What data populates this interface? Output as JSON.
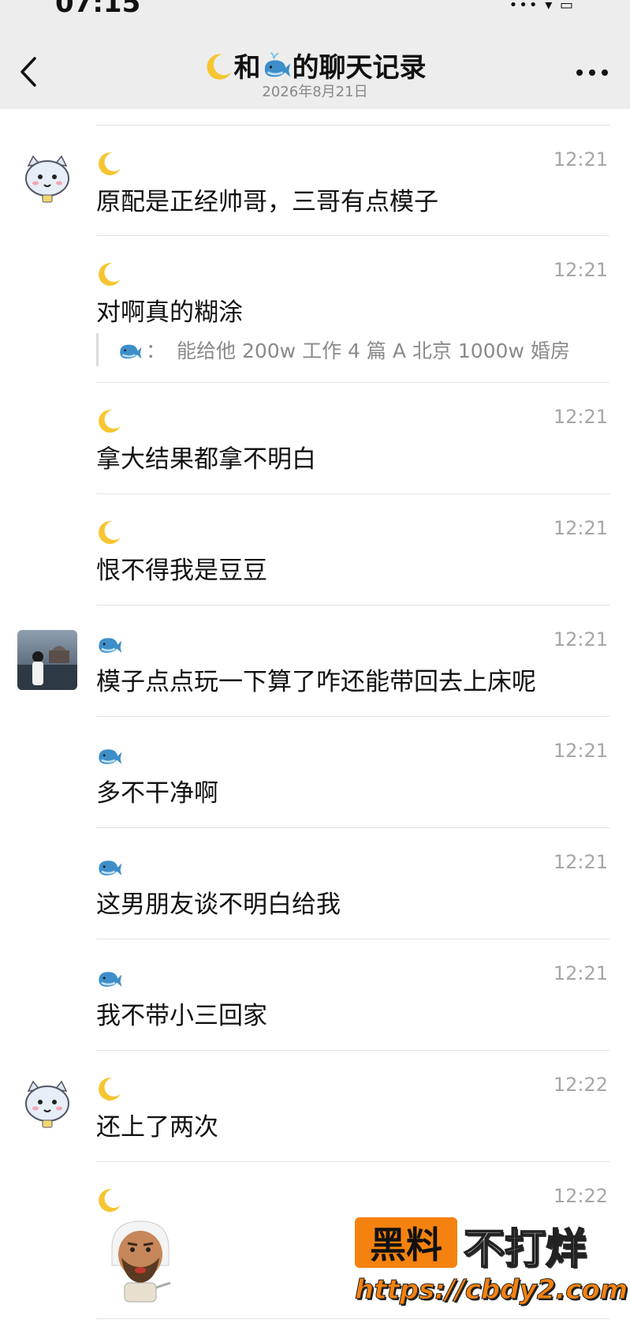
{
  "status_bar": {
    "time": "07:15",
    "indicators": "•••  ▾  ▭"
  },
  "header": {
    "title_left_icon": "moon-emoji",
    "title_mid": "和",
    "title_right_icon": "whale-emoji",
    "title_suffix": "的聊天记录",
    "date": "2026年8月21日",
    "back_icon": "chevron-left-icon",
    "more_icon": "more-dots-icon"
  },
  "messages": [
    {
      "sender": "moon",
      "avatar": "cat-avatar",
      "time": "12:21",
      "text": "原配是正经帅哥，三哥有点模子"
    },
    {
      "sender": "moon",
      "avatar": "",
      "time": "12:21",
      "text": "对啊真的糊涂",
      "quote": {
        "sender_icon": "whale-emoji",
        "colon": "：",
        "text": "能给他 200w 工作 4 篇 A 北京 1000w 婚房"
      }
    },
    {
      "sender": "moon",
      "avatar": "",
      "time": "12:21",
      "text": "拿大结果都拿不明白"
    },
    {
      "sender": "moon",
      "avatar": "",
      "time": "12:21",
      "text": "恨不得我是豆豆"
    },
    {
      "sender": "whale",
      "avatar": "photo-avatar",
      "time": "12:21",
      "text": "模子点点玩一下算了咋还能带回去上床呢"
    },
    {
      "sender": "whale",
      "avatar": "",
      "time": "12:21",
      "text": "多不干净啊"
    },
    {
      "sender": "whale",
      "avatar": "",
      "time": "12:21",
      "text": "这男朋友谈不明白给我"
    },
    {
      "sender": "whale",
      "avatar": "",
      "time": "12:21",
      "text": "我不带小三回家"
    },
    {
      "sender": "moon",
      "avatar": "cat-avatar",
      "time": "12:22",
      "text": "还上了两次"
    },
    {
      "sender": "moon",
      "avatar": "",
      "time": "12:22",
      "text": "",
      "sticker": "bearded-man-sticker"
    }
  ],
  "watermark": {
    "box_text": "黑料",
    "side_text": "不打烊",
    "url": "https://cbdy2.com"
  },
  "colors": {
    "header_bg": "#ededed",
    "time_gray": "#a6a6a6",
    "watermark_orange": "#f5820f"
  }
}
